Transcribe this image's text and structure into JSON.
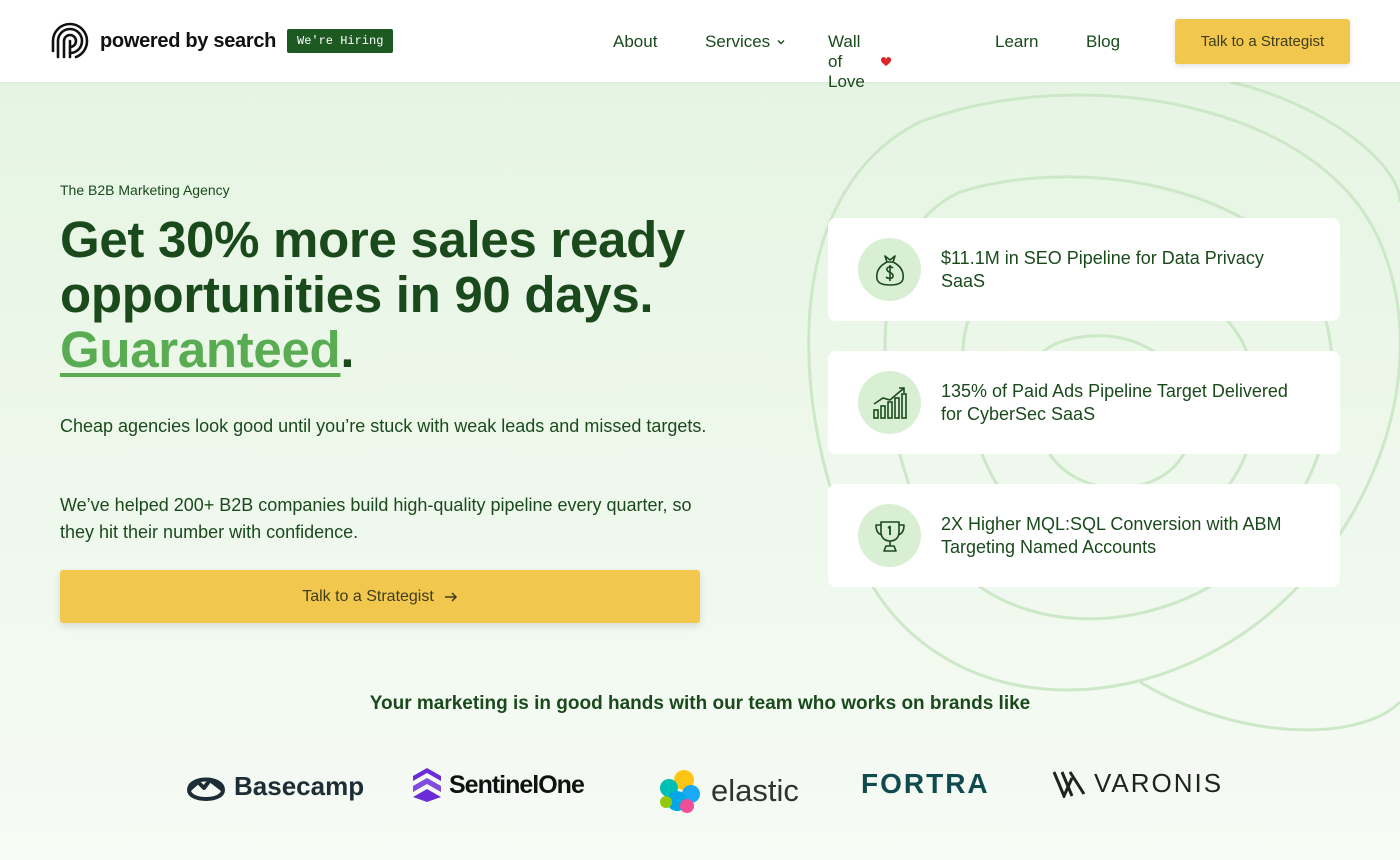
{
  "header": {
    "logo_text": "powered by search",
    "hiring_badge": "We're Hiring",
    "nav": {
      "about": "About",
      "services": "Services",
      "wall_of_love": "Wall of Love",
      "wall_icon": "heart-icon",
      "learn": "Learn",
      "blog": "Blog"
    },
    "cta": "Talk to a Strategist"
  },
  "hero": {
    "eyebrow": "The B2B Marketing Agency",
    "headline_1": "Get 30% more sales ready",
    "headline_2": "opportunities in 90 days.",
    "headline_highlight": "Guaranteed",
    "headline_end": ".",
    "paragraph_1": "Cheap agencies look good until you’re stuck with weak leads and missed targets.",
    "paragraph_2": "We’ve helped 200+ B2B companies build high-quality pipeline every quarter, so they hit their number with confidence.",
    "cta": "Talk to a Strategist",
    "cta_icon": "arrow-right-icon"
  },
  "results": [
    {
      "icon": "money-bag-icon",
      "text": "$11.1M in SEO Pipeline for Data Privacy SaaS"
    },
    {
      "icon": "growth-chart-icon",
      "text": "135% of Paid Ads Pipeline Target Delivered for CyberSec SaaS"
    },
    {
      "icon": "trophy-icon",
      "text": "2X Higher MQL:SQL Conversion with ABM Targeting Named Accounts"
    }
  ],
  "brands": {
    "title": "Your marketing is in good hands with our team who works on brands like",
    "logos": [
      "Basecamp",
      "SentinelOne",
      "elastic",
      "FORTRA",
      "VARONIS"
    ]
  },
  "colors": {
    "primary_green": "#1a4a1c",
    "accent_green": "#5aac52",
    "cta_yellow": "#f2c74e",
    "badge_green": "#1d5a22"
  }
}
